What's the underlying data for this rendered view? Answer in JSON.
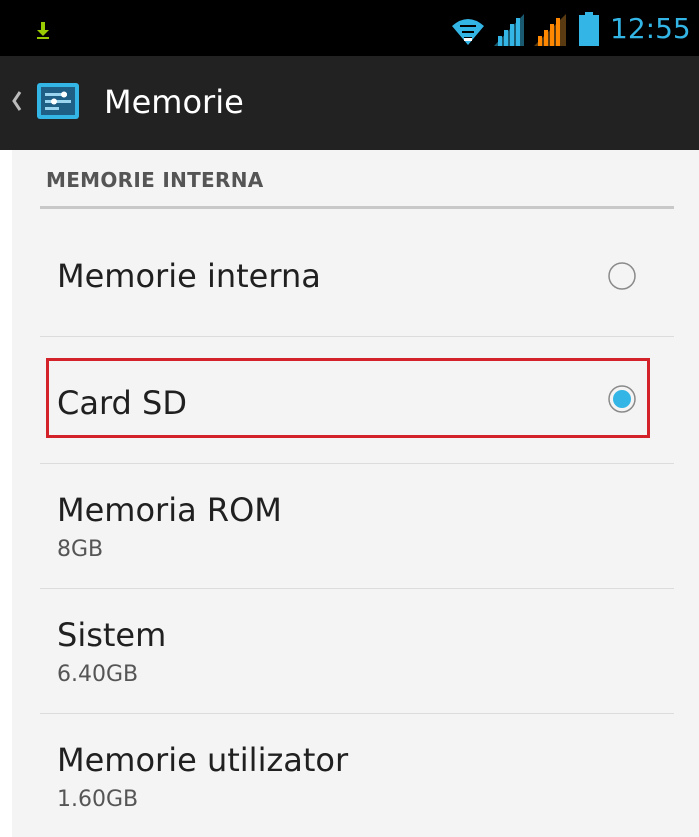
{
  "status_bar": {
    "time": "12:55",
    "icons": [
      "download-icon",
      "wifi-icon",
      "signal-icon",
      "signal-roaming-icon",
      "battery-icon"
    ],
    "accent_color": "#33b5e5"
  },
  "action_bar": {
    "title": "Memorie",
    "icons": [
      "back-icon",
      "storage-settings-icon"
    ]
  },
  "section": {
    "header": "MEMORIE INTERNA"
  },
  "options": [
    {
      "title": "Memorie interna",
      "selected": false
    },
    {
      "title": "Card SD",
      "selected": true
    }
  ],
  "info_items": [
    {
      "title": "Memoria ROM",
      "value": "8GB"
    },
    {
      "title": "Sistem",
      "value": "6.40GB"
    },
    {
      "title": "Memorie utilizator",
      "value": "1.60GB"
    }
  ],
  "highlight_color": "#d4222a"
}
